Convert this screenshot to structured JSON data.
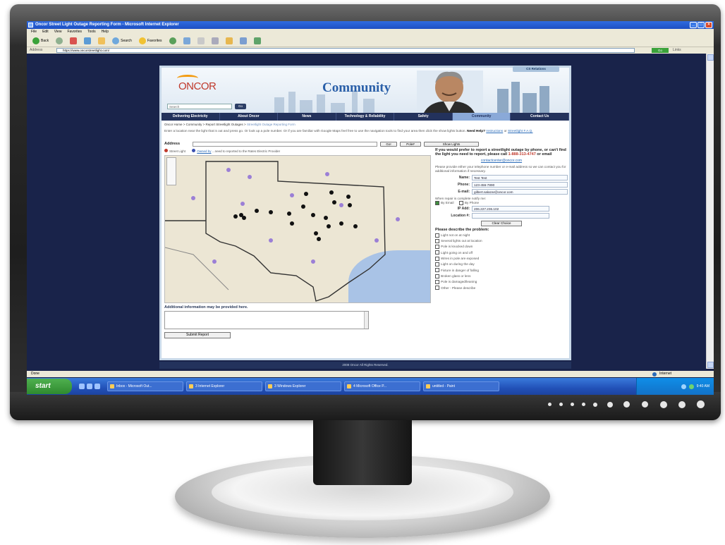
{
  "window": {
    "title": "Oncor Street Light Outage Reporting Form - Microsoft Internet Explorer"
  },
  "menubar": [
    "File",
    "Edit",
    "View",
    "Favorites",
    "Tools",
    "Help"
  ],
  "toolbar": {
    "back": "Back",
    "search": "Search",
    "favorites": "Favorites"
  },
  "addressbar": {
    "label": "Address",
    "url": "https://www.oncorstreetlight.com/",
    "go": "Go",
    "links": "Links"
  },
  "site": {
    "logo": "ONCOR",
    "header_title": "Community",
    "cs_relations": "CS Relations",
    "search_placeholder": "Search",
    "search_go": "Go",
    "nav": [
      "Delivering Electricity",
      "About Oncor",
      "News",
      "Technology & Reliability",
      "Safety",
      "Community",
      "Contact Us"
    ],
    "active_nav": "Community",
    "breadcrumb": {
      "trail": "Oncor Home  >  Community  >  Report Streetlight Outages  >",
      "current": "Streetlight Outage Reporting Form"
    },
    "intro": {
      "text": "Enter a location near the light that is out and press go. Or look up a pole number. Or if you are familiar with Google Maps feel free to use the navigation tools to find your area then click the show lights button.",
      "help_label": "Need Help?",
      "link1": "Instructions",
      "or": "or",
      "link2": "Streetlight F.A.Q."
    },
    "address_form": {
      "label": "Address",
      "go": "Go!",
      "pole": "Pole#",
      "show_lights": "Show Lights"
    },
    "legend": {
      "street_light": "Street Light",
      "owned_by": "Owned by",
      "rest": "...need to reported to the Rates Electric Provider"
    },
    "additional_info_label": "Additional information may be provided here.",
    "submit": "Submit Report",
    "footer": "2008 Oncor All Rights Reserved."
  },
  "sidebar": {
    "phone_text_1": "If you would prefer to report a streetlight outage by phone, or can't find the light you need to report, please call",
    "phone_number": "1-888-313-4747",
    "phone_text_2": "or email",
    "email": "contactcenter@oncor.com",
    "provide_info": "Please provide either your telephone number or e-mail address so we can contact you for additional information if necessary.",
    "fields": [
      {
        "label": "Name:",
        "value": "Test Test"
      },
      {
        "label": "Phone:",
        "value": "123-456-7890"
      },
      {
        "label": "E-mail:",
        "value": "gilbert.salazar@oncor.com"
      }
    ],
    "notify_text": "When repair is complete notify me:",
    "notify_email": "By Email",
    "notify_phone": "By Phone",
    "ip_label": "IP Add:",
    "ip_value": "206.227.236.102",
    "location_label": "Location #:",
    "clear_choice": "Clear Choice",
    "problem_heading": "Please describe the problem:",
    "problems": [
      "Light not on at night",
      "Several lights out at location",
      "Pole is knocked down",
      "Light going on and off",
      "Wires in pole are exposed",
      "Light on during the day",
      "Fixture in danger of falling",
      "Broken glass or lens",
      "Pole is damaged/leaning",
      "Other - Please describe"
    ]
  },
  "statusbar": {
    "left": "Done",
    "zone": "Internet"
  },
  "taskbar": {
    "start": "start",
    "tasks": [
      "Inbox - Microsoft Out...",
      "3 Internet Explorer",
      "3 Windows Explorer",
      "4 Microsoft Office P...",
      "untitled - Paint"
    ],
    "clock": "9:40 AM"
  },
  "colors": {
    "nav_bg": "#23325c",
    "brand_red": "#c0392b",
    "link": "#2a6bb8"
  }
}
